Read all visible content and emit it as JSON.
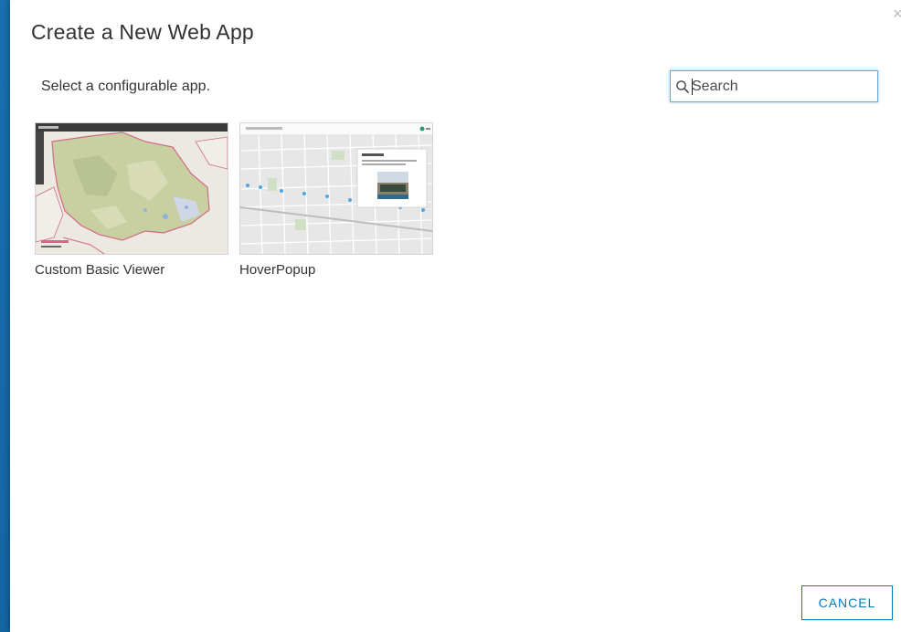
{
  "dialog": {
    "title": "Create a New Web App",
    "subtitle": "Select a configurable app.",
    "close_icon": "close-icon"
  },
  "search": {
    "placeholder": "Search",
    "value": "",
    "icon": "search-icon"
  },
  "apps": [
    {
      "label": "Custom Basic Viewer",
      "thumbnail": "map-thumbnail-custom-basic-viewer"
    },
    {
      "label": "HoverPopup",
      "thumbnail": "map-thumbnail-hoverpopup"
    }
  ],
  "footer": {
    "cancel_label": "CANCEL"
  },
  "colors": {
    "accent": "#0079c1",
    "backdrop": "#1a6fae",
    "text": "#333333"
  }
}
